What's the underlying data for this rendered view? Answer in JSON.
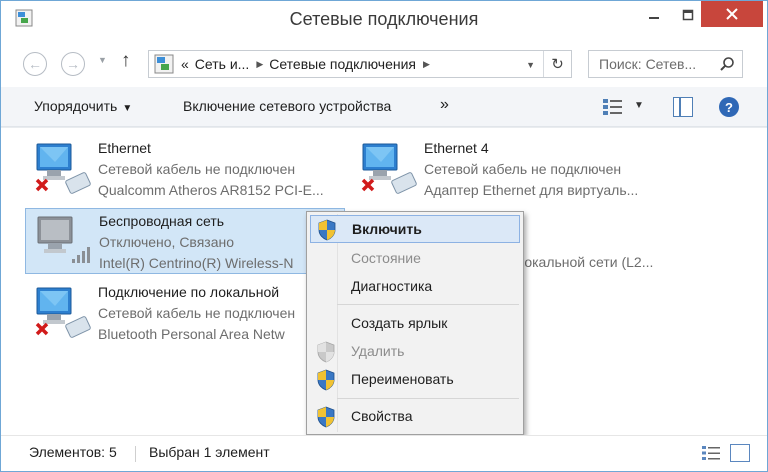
{
  "window": {
    "title": "Сетевые подключения",
    "accent_close": "#c8463c"
  },
  "address": {
    "segments": [
      "«",
      "Сеть и...",
      "Сетевые подключения"
    ],
    "search_placeholder": "Поиск: Сетев..."
  },
  "toolbar": {
    "organize_label": "Упорядочить",
    "enable_label": "Включение сетевого устройства",
    "more_label": "»"
  },
  "connections": [
    {
      "name": "Ethernet",
      "status": "Сетевой кабель не подключен",
      "device": "Qualcomm Atheros AR8152 PCI-E..."
    },
    {
      "name": "Ethernet 4",
      "status": "Сетевой кабель не подключен",
      "device": "Адаптер Ethernet для виртуаль..."
    },
    {
      "name": "Беспроводная сеть",
      "status": "Отключено, Связано",
      "device": "Intel(R) Centrino(R) Wireless-N"
    },
    {
      "name": "",
      "status": "",
      "device": "локальной сети (L2..."
    },
    {
      "name": "Подключение по локальной",
      "status": "Сетевой кабель не подключен",
      "device": "Bluetooth Personal Area Netw"
    }
  ],
  "context_menu": {
    "items": [
      {
        "label": "Включить",
        "shield": true,
        "bold": true,
        "disabled": false
      },
      {
        "label": "Состояние",
        "shield": false,
        "bold": false,
        "disabled": true
      },
      {
        "label": "Диагностика",
        "shield": false,
        "bold": false,
        "disabled": false
      },
      {
        "label": "Создать ярлык",
        "shield": false,
        "bold": false,
        "disabled": false
      },
      {
        "label": "Удалить",
        "shield": true,
        "bold": false,
        "disabled": true
      },
      {
        "label": "Переименовать",
        "shield": true,
        "bold": false,
        "disabled": false
      },
      {
        "label": "Свойства",
        "shield": true,
        "bold": false,
        "disabled": false
      }
    ]
  },
  "statusbar": {
    "count": "Элементов: 5",
    "selected": "Выбран 1 элемент"
  }
}
